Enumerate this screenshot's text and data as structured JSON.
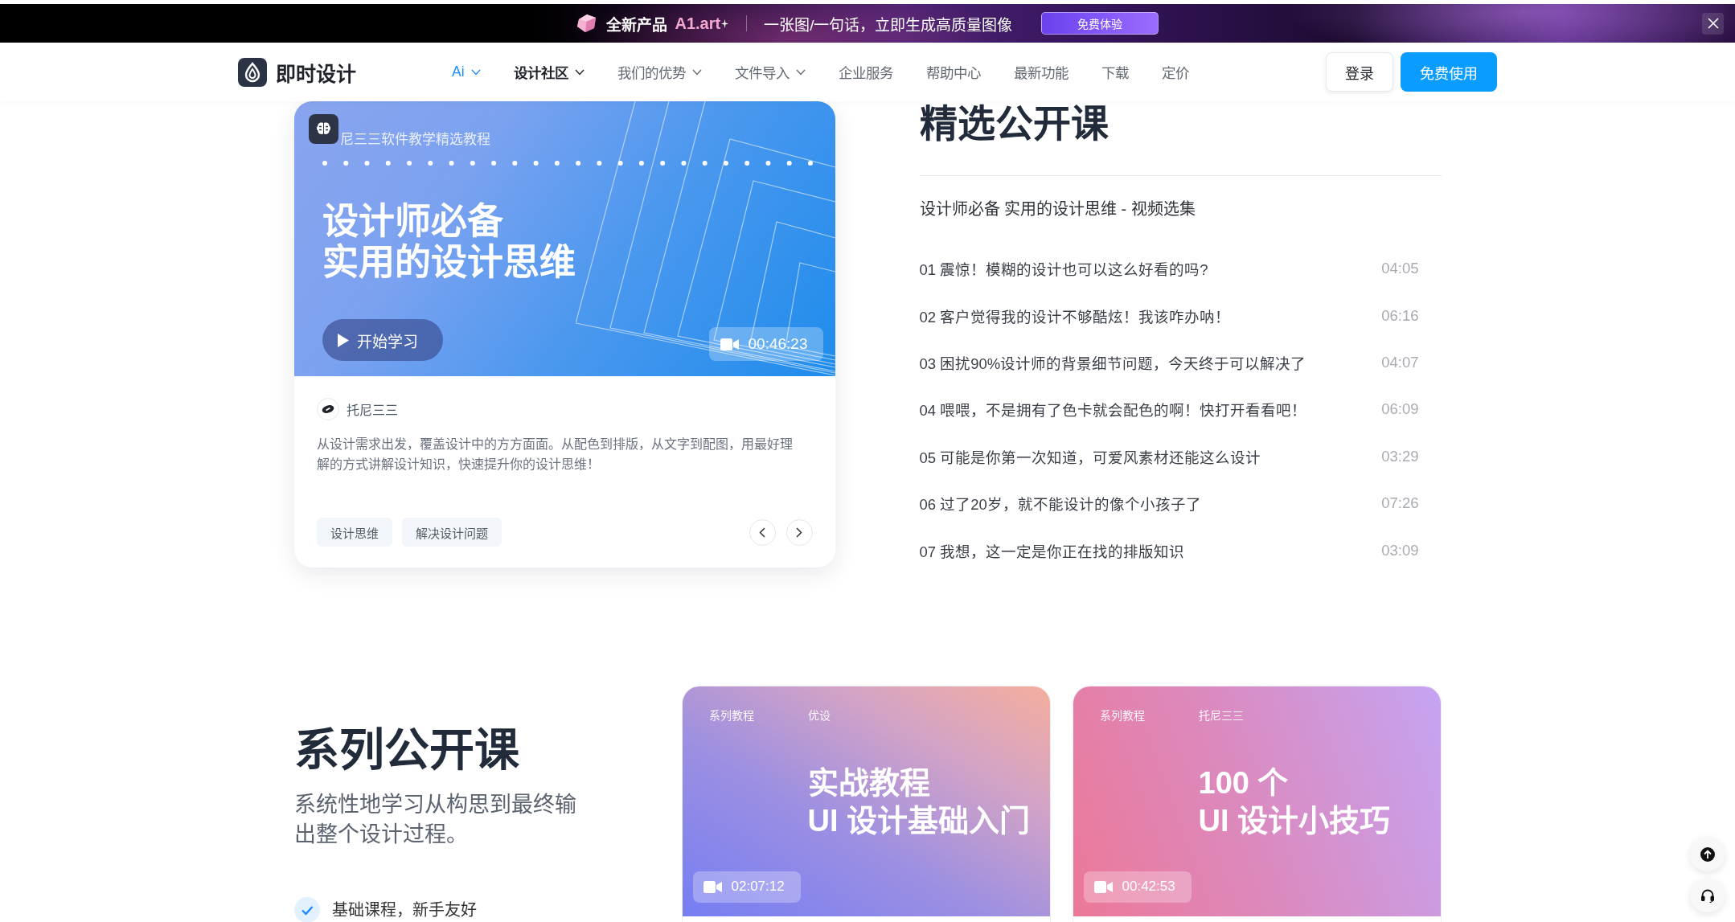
{
  "promo_banner": {
    "label": "全新产品",
    "product": "A1.art",
    "tagline": "一张图/一句话，立即生成高质量图像",
    "button": "免费体验"
  },
  "navbar": {
    "brand": "即时设计",
    "items": [
      {
        "label": "Ai",
        "kind": "highlight",
        "dropdown": true,
        "selected": false
      },
      {
        "label": "设计社区",
        "kind": "plain",
        "dropdown": true,
        "selected": true
      },
      {
        "label": "我们的优势",
        "kind": "plain",
        "dropdown": true,
        "selected": false
      },
      {
        "label": "文件导入",
        "kind": "plain",
        "dropdown": true,
        "selected": false
      },
      {
        "label": "企业服务",
        "kind": "plain",
        "dropdown": false,
        "selected": false
      },
      {
        "label": "帮助中心",
        "kind": "plain",
        "dropdown": false,
        "selected": false
      },
      {
        "label": "最新功能",
        "kind": "plain",
        "dropdown": false,
        "selected": false
      },
      {
        "label": "下载",
        "kind": "plain",
        "dropdown": false,
        "selected": false
      },
      {
        "label": "定价",
        "kind": "plain",
        "dropdown": false,
        "selected": false
      }
    ],
    "login_button": "登录",
    "signup_button": "免费使用"
  },
  "featured_course": {
    "series_label": "尼三三软件教学精选教程",
    "title_lines": [
      "设计师必备",
      "实用的设计思维"
    ],
    "start_button": "开始学习",
    "duration": "00:46:23",
    "author": "托尼三三",
    "description": "从设计需求出发，覆盖设计中的方方面面。从配色到排版，从文字到配图，用最好理解的方式讲解设计知识，快速提升你的设计思维！",
    "tags": [
      "设计思维",
      "解决设计问题"
    ]
  },
  "featured_list": {
    "heading": "精选公开课",
    "subtitle": "设计师必备 实用的设计思维 - 视频选集",
    "episodes": [
      {
        "title": "01 震惊！模糊的设计也可以这么好看的吗?",
        "duration": "04:05"
      },
      {
        "title": "02 客户觉得我的设计不够酷炫！我该咋办呐！",
        "duration": "06:16"
      },
      {
        "title": "03 困扰90%设计师的背景细节问题，今天终于可以解决了",
        "duration": "04:07"
      },
      {
        "title": "04 喂喂，不是拥有了色卡就会配色的啊！快打开看看吧！",
        "duration": "06:09"
      },
      {
        "title": "05 可能是你第一次知道，可爱风素材还能这么设计",
        "duration": "03:29"
      },
      {
        "title": "06 过了20岁，就不能设计的像个小孩子了",
        "duration": "07:26"
      },
      {
        "title": "07 我想，这一定是你正在找的排版知识",
        "duration": "03:09"
      }
    ]
  },
  "series_section": {
    "heading": "系列公开课",
    "description": "系统性地学习从构思到最终输出整个设计过程。",
    "features": [
      {
        "label": "基础课程，新手友好",
        "checked": true
      }
    ],
    "courses": [
      {
        "kind": "violet",
        "category": "系列教程",
        "author": "优设",
        "title": "实战教程\nUI 设计基础入门",
        "duration": "02:07:12"
      },
      {
        "kind": "pink",
        "category": "系列教程",
        "author": "托尼三三",
        "title": "100 个\nUI 设计小技巧",
        "duration": "00:42:53"
      }
    ]
  }
}
